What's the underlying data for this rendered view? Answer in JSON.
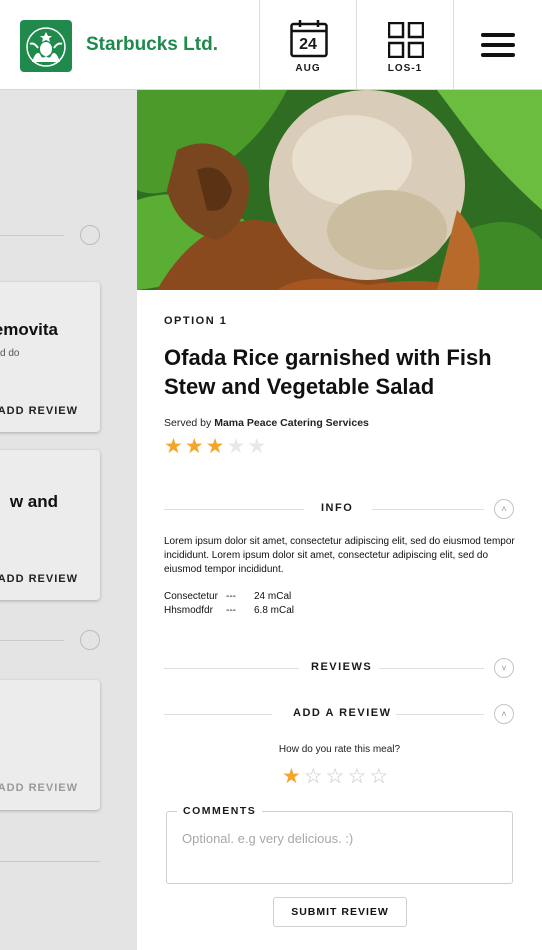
{
  "header": {
    "brand": "Starbucks Ltd.",
    "calendar": {
      "day": "24",
      "month": "AUG"
    },
    "location": {
      "label": "LOS-1"
    }
  },
  "left_panel": {
    "cards": [
      {
        "title": "emovita",
        "subtitle": "d do",
        "review": "ADD REVIEW"
      },
      {
        "title": "w and",
        "review": "ADD REVIEW"
      },
      {
        "title": "",
        "review": "ADD REVIEW"
      }
    ]
  },
  "meal": {
    "option": "OPTION 1",
    "title": "Ofada Rice garnished with Fish Stew and Vegetable Salad",
    "served_by_prefix": "Served by ",
    "served_by": "Mama Peace Catering Services",
    "rating": 3,
    "rating_max": 5
  },
  "info": {
    "label": "INFO",
    "text": "Lorem ipsum dolor sit amet, consectetur adipiscing elit, sed do eiusmod tempor incididunt. Lorem ipsum dolor sit amet, consectetur adipiscing elit, sed do eiusmod tempor incididunt.",
    "nutrition": [
      {
        "name": "Consectetur",
        "sep": "---",
        "value": "24 mCal"
      },
      {
        "name": "Hhsmodfdr",
        "sep": "---",
        "value": "6.8 mCal"
      }
    ]
  },
  "reviews": {
    "label": "REVIEWS"
  },
  "add_review": {
    "label": "ADD A REVIEW",
    "question": "How do you rate this meal?",
    "rating": 1,
    "rating_max": 5,
    "comments_label": "COMMENTS",
    "comments_placeholder": "Optional. e.g very delicious. :)",
    "submit": "SUBMIT REVIEW"
  },
  "colors": {
    "brand_green": "#1f8a4c",
    "star_filled": "#f4a52a",
    "star_empty": "#e8e8e8"
  },
  "icons": [
    "starbucks-logo",
    "calendar-icon",
    "grid-icon",
    "menu-icon",
    "chevron-up-icon",
    "chevron-down-icon",
    "star-icon"
  ]
}
